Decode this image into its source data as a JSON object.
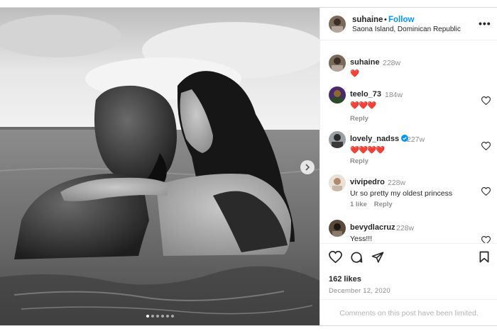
{
  "post": {
    "username": "suhaine",
    "separator": "•",
    "follow_label": "Follow",
    "location": "Saona Island, Dominican Republic",
    "more_label": "•••",
    "carousel_dots": 6,
    "carousel_active_index": 0
  },
  "comments": [
    {
      "username": "suhaine",
      "time": "228w",
      "text": "❤️",
      "verified": false
    },
    {
      "username": "teelo_73",
      "time": "184w",
      "text": "❤️❤️❤️",
      "reply_label": "Reply",
      "verified": false
    },
    {
      "username": "lovely_nadss",
      "time": "227w",
      "text": "❤️❤️❤️❤️",
      "reply_label": "Reply",
      "verified": true
    },
    {
      "username": "vivipedro",
      "time": "228w",
      "text": "Ur so pretty my oldest princess",
      "likes_label": "1 like",
      "reply_label": "Reply",
      "verified": false
    },
    {
      "username": "bevydlacruz",
      "time": "228w",
      "text": "Yess!!!\nNice pic!!!",
      "verified": false
    }
  ],
  "actions": {
    "likes": "162 likes",
    "date": "December 12, 2020",
    "limited_notice": "Comments on this post have been limited."
  },
  "colors": {
    "accent": "#0095f6",
    "heart": "#ed1c3f",
    "muted": "#8e8e8e",
    "text": "#262626"
  }
}
